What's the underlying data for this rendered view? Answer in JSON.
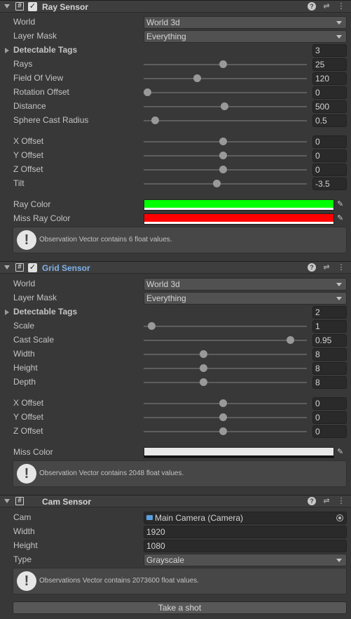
{
  "ray_sensor": {
    "title": "Ray Sensor",
    "world": {
      "label": "World",
      "value": "World 3d"
    },
    "layer_mask": {
      "label": "Layer Mask",
      "value": "Everything"
    },
    "detectable_tags": {
      "label": "Detectable Tags",
      "value": "3"
    },
    "rays": {
      "label": "Rays",
      "value": "25",
      "fraction": 0.5
    },
    "fov": {
      "label": "Field Of View",
      "value": "120",
      "fraction": 0.33
    },
    "rotation_offset": {
      "label": "Rotation Offset",
      "value": "0",
      "fraction": 0.0
    },
    "distance": {
      "label": "Distance",
      "value": "500",
      "fraction": 0.51
    },
    "sphere_cast_radius": {
      "label": "Sphere Cast Radius",
      "value": "0.5",
      "fraction": 0.05
    },
    "x_offset": {
      "label": "X Offset",
      "value": "0",
      "fraction": 0.5
    },
    "y_offset": {
      "label": "Y Offset",
      "value": "0",
      "fraction": 0.5
    },
    "z_offset": {
      "label": "Z Offset",
      "value": "0",
      "fraction": 0.5
    },
    "tilt": {
      "label": "Tilt",
      "value": "-3.5",
      "fraction": 0.46
    },
    "ray_color": {
      "label": "Ray Color",
      "color": "#00ff00"
    },
    "miss_ray_color": {
      "label": "Miss Ray Color",
      "color": "#ff0000"
    },
    "help": "Observation Vector contains 6 float values."
  },
  "grid_sensor": {
    "title": "Grid Sensor",
    "world": {
      "label": "World",
      "value": "World 3d"
    },
    "layer_mask": {
      "label": "Layer Mask",
      "value": "Everything"
    },
    "detectable_tags": {
      "label": "Detectable Tags",
      "value": "2"
    },
    "scale": {
      "label": "Scale",
      "value": "1",
      "fraction": 0.03
    },
    "cast_scale": {
      "label": "Cast Scale",
      "value": "0.95",
      "fraction": 0.95
    },
    "width": {
      "label": "Width",
      "value": "8",
      "fraction": 0.37
    },
    "height": {
      "label": "Height",
      "value": "8",
      "fraction": 0.37
    },
    "depth": {
      "label": "Depth",
      "value": "8",
      "fraction": 0.37
    },
    "x_offset": {
      "label": "X Offset",
      "value": "0",
      "fraction": 0.5
    },
    "y_offset": {
      "label": "Y Offset",
      "value": "0",
      "fraction": 0.5
    },
    "z_offset": {
      "label": "Z Offset",
      "value": "0",
      "fraction": 0.5
    },
    "miss_color": {
      "label": "Miss Color",
      "color": "#e8e8e8"
    },
    "help": "Observation Vector contains 2048 float values."
  },
  "cam_sensor": {
    "title": "Cam Sensor",
    "cam": {
      "label": "Cam",
      "value": "Main Camera (Camera)"
    },
    "width": {
      "label": "Width",
      "value": "1920"
    },
    "height": {
      "label": "Height",
      "value": "1080"
    },
    "type": {
      "label": "Type",
      "value": "Grayscale"
    },
    "help": "Observations Vector contains 2073600 float values.",
    "button": "Take a shot"
  },
  "icons": {
    "help": "?",
    "presets": "⇌",
    "menu": "⋮",
    "script": "#",
    "check": "✓",
    "eyedropper": "✎",
    "warning": "!"
  }
}
